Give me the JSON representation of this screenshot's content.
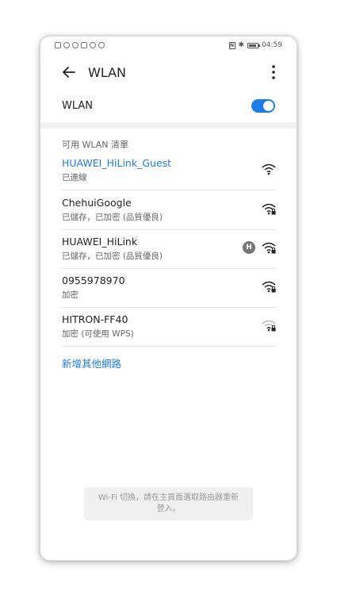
{
  "status_bar": {
    "time": "04:59"
  },
  "appbar": {
    "title": "WLAN"
  },
  "wlan_toggle": {
    "label": "WLAN",
    "enabled": true
  },
  "networks_header": "可用 WLAN 清單",
  "networks": [
    {
      "name": "HUAWEI_HiLink_Guest",
      "status": "已連線",
      "connected": true,
      "secured": false,
      "signal": "full"
    },
    {
      "name": "ChehuiGoogle",
      "status": "已儲存，已加密 (品質優良)",
      "connected": false,
      "secured": true,
      "signal": "full"
    },
    {
      "name": "HUAWEI_HiLink",
      "status": "已儲存，已加密 (品質優良)",
      "connected": false,
      "secured": true,
      "signal": "full",
      "badge": "hilink-icon"
    },
    {
      "name": "0955978970",
      "status": "加密",
      "connected": false,
      "secured": true,
      "signal": "full"
    },
    {
      "name": "HITRON-FF40",
      "status": "加密 (可使用 WPS)",
      "connected": false,
      "secured": true,
      "signal": "weak"
    }
  ],
  "add_network_label": "新增其他網路",
  "toast": {
    "line1": "Wi-Fi 切換，請在主頁面選取路由器重新",
    "line2": "登入。"
  },
  "colors": {
    "accent": "#1f7be6",
    "divider": "#e6e6e6"
  }
}
